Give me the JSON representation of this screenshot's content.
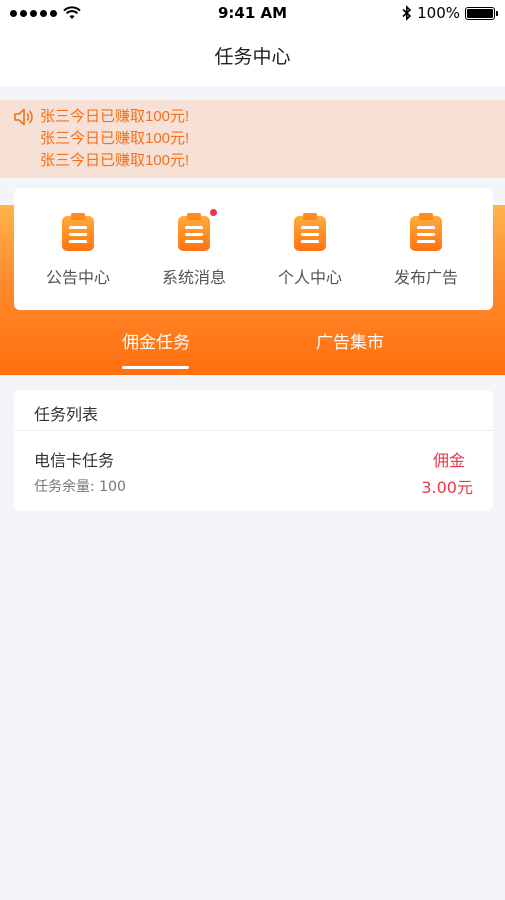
{
  "status_bar": {
    "time": "9:41 AM",
    "battery": "100%",
    "signal_icon": "signal-dots-icon",
    "wifi_icon": "wifi-icon",
    "bluetooth_icon": "bluetooth-icon",
    "battery_level": 1.0
  },
  "nav": {
    "title": "任务中心"
  },
  "notice": {
    "icon": "speaker-icon",
    "lines": [
      "张三今日已赚取100元!",
      "张三今日已赚取100元!",
      "张三今日已赚取100元!"
    ]
  },
  "quick_menu": [
    {
      "label": "公告中心",
      "icon": "clipboard-icon",
      "badge": false
    },
    {
      "label": "系统消息",
      "icon": "clipboard-icon",
      "badge": true
    },
    {
      "label": "个人中心",
      "icon": "clipboard-icon",
      "badge": false
    },
    {
      "label": "发布广告",
      "icon": "clipboard-icon",
      "badge": false
    }
  ],
  "tabs": [
    {
      "label": "佣金任务",
      "active": true
    },
    {
      "label": "广告集市",
      "active": false
    }
  ],
  "task_list": {
    "title": "任务列表",
    "items": [
      {
        "name": "电信卡任务",
        "remain_label": "任务余量:",
        "remain_value": "100",
        "commission_label": "佣金",
        "commission_value": "3.00元"
      }
    ]
  },
  "colors": {
    "accent_orange": "#ff7a1c",
    "notice_bg": "#f7e1d6",
    "notice_text": "#f2711c",
    "commission_red": "#e8394a",
    "page_bg": "#f4f5f9"
  }
}
